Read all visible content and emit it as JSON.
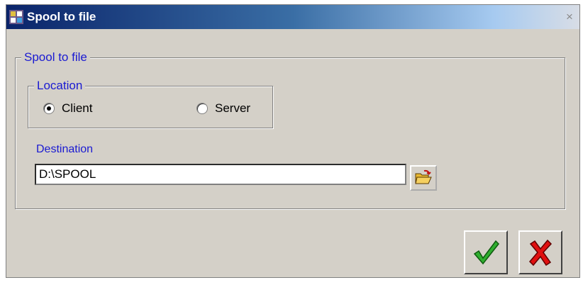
{
  "window": {
    "title": "Spool to file",
    "close_glyph": "×"
  },
  "group": {
    "label": "Spool to file"
  },
  "location": {
    "label": "Location",
    "options": [
      {
        "label": "Client",
        "checked": true
      },
      {
        "label": "Server",
        "checked": false
      }
    ]
  },
  "destination": {
    "label": "Destination",
    "value": "D:\\SPOOL"
  },
  "icons": {
    "app": "app-icon",
    "browse": "open-folder-icon",
    "ok": "checkmark-icon",
    "cancel": "x-icon"
  },
  "colors": {
    "title_start": "#0a246a",
    "label_blue": "#1a1ad2",
    "ok_green": "#2fae2f",
    "cancel_red": "#e01010"
  }
}
